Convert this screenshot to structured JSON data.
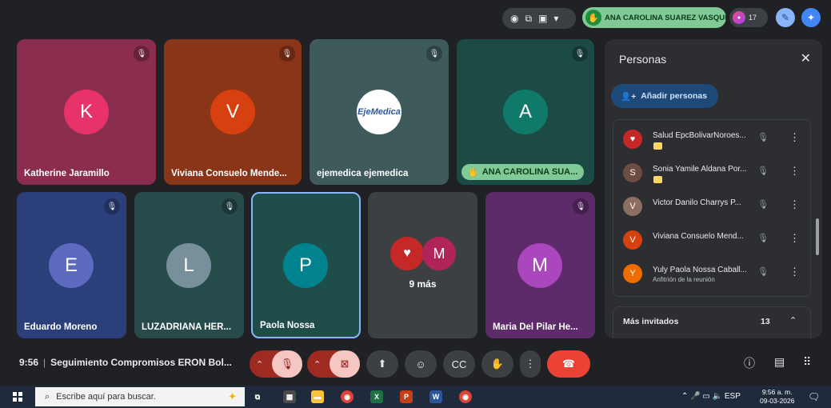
{
  "top_bar": {
    "record_icon": "record-icon",
    "presenter_name": "ANA CAROLINA SUAREZ VASQUE",
    "participant_count": "17"
  },
  "tiles": [
    {
      "name": "Katherine Jaramillo",
      "initial": "K",
      "bg": "#8b2d4f",
      "avatar_color": "#e8336a"
    },
    {
      "name": "Viviana Consuelo Mende...",
      "initial": "V",
      "bg": "#8a3418",
      "avatar_color": "#d7400f"
    },
    {
      "name": "ejemedica ejemedica",
      "initial": "",
      "logo_text": "EjeMedica",
      "bg": "#3e5a5a",
      "avatar_color": "#ffffff"
    },
    {
      "name": "ANA CAROLINA SUA...",
      "initial": "A",
      "bg": "#1c4a45",
      "avatar_color": "#0f7a6a"
    },
    {
      "name": "Eduardo Moreno",
      "initial": "E",
      "bg": "#2b3f7a",
      "avatar_color": "#5c6bc0"
    },
    {
      "name": "LUZADRIANA HER...",
      "initial": "L",
      "bg": "#274a4a",
      "avatar_color": "#78909c"
    },
    {
      "name": "Paola Nossa",
      "initial": "P",
      "bg": "#1f4d4a",
      "avatar_color": "#00838f"
    },
    {
      "name": "9 más",
      "initial": "M",
      "bg": "#3c4043",
      "avatar_color": "#b0245a"
    },
    {
      "name": "Maria Del Pilar He...",
      "initial": "M",
      "bg": "#5d2a6a",
      "avatar_color": "#ab47bc"
    }
  ],
  "panel": {
    "title": "Personas",
    "add_label": "Añadir personas",
    "people": [
      {
        "name": "Salud EpcBolivarNoroes...",
        "initial": "♥",
        "color": "#c62828",
        "sub": ""
      },
      {
        "name": "Sonia Yamile Aldana Por...",
        "initial": "S",
        "color": "#6d4c41",
        "sub": ""
      },
      {
        "name": "Victor Danilo Charrys P...",
        "initial": "V",
        "color": "#8d6e63",
        "sub": ""
      },
      {
        "name": "Viviana Consuelo Mend...",
        "initial": "V",
        "color": "#d7400f",
        "sub": ""
      },
      {
        "name": "Yuly Paola Nossa Caball...",
        "initial": "Y",
        "color": "#ef6c00",
        "sub": "Anfitrión de la reunión"
      }
    ],
    "more_invited_label": "Más invitados",
    "more_invited_count": "13"
  },
  "bottom_bar": {
    "time": "9:56",
    "meeting_title": "Seguimiento Compromisos ERON Bol..."
  },
  "taskbar": {
    "search_placeholder": "Escribe aquí para buscar.",
    "lang": "ESP",
    "clock_time": "9:56 a. m.",
    "clock_date": "09-03-2026"
  }
}
